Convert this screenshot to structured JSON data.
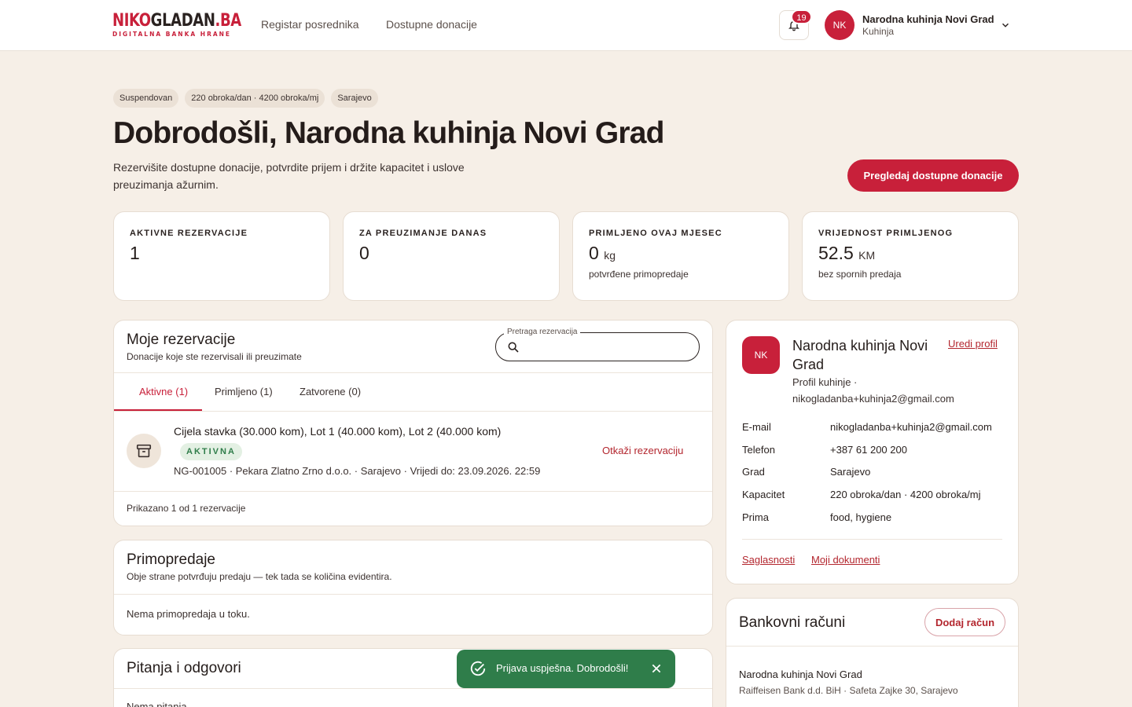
{
  "brand": {
    "logo_part1": "NIKO",
    "logo_part2": "GLADAN",
    "logo_part3": ".BA",
    "tagline": "DIGITALNA BANKA HRANE",
    "accent": "#c8203a"
  },
  "nav": {
    "link1": "Registar posrednika",
    "link2": "Dostupne donacije"
  },
  "header": {
    "notifications_count": "19",
    "user_initials": "NK",
    "user_name": "Narodna kuhinja Novi Grad",
    "user_role": "Kuhinja"
  },
  "hero": {
    "chips": [
      "Suspendovan",
      "220 obroka/dan · 4200 obroka/mj",
      "Sarajevo"
    ],
    "title": "Dobrodošli, Narodna kuhinja Novi Grad",
    "subtitle": "Rezervišite dostupne donacije, potvrdite prijem i držite kapacitet i uslove preuzimanja ažurnim.",
    "cta": "Pregledaj dostupne donacije"
  },
  "stats": [
    {
      "label": "AKTIVNE REZERVACIJE",
      "value": "1",
      "unit": "",
      "note": ""
    },
    {
      "label": "ZA PREUZIMANJE DANAS",
      "value": "0",
      "unit": "",
      "note": ""
    },
    {
      "label": "PRIMLJENO OVAJ MJESEC",
      "value": "0",
      "unit": "kg",
      "note": "potvrđene primopredaje"
    },
    {
      "label": "VRIJEDNOST PRIMLJENOG",
      "value": "52.5",
      "unit": "KM",
      "note": "bez spornih predaja"
    }
  ],
  "reservations": {
    "title": "Moje rezervacije",
    "description": "Donacije koje ste rezervisali ili preuzimate",
    "search_label": "Pretraga rezervacija",
    "search_value": "",
    "tabs": [
      "Aktivne (1)",
      "Primljeno (1)",
      "Zatvorene (0)"
    ],
    "items": [
      {
        "title": "Cijela stavka (30.000 kom), Lot 1 (40.000 kom), Lot 2 (40.000 kom)",
        "status": "AKTIVNA",
        "meta": "NG-001005 · Pekara Zlatno Zrno d.o.o. · Sarajevo · Vrijedi do: 23.09.2026. 22:59",
        "action": "Otkaži rezervaciju"
      }
    ],
    "footer": "Prikazano 1 od 1 rezervacije"
  },
  "handovers": {
    "title": "Primopredaje",
    "description": "Obje strane potvrđuju predaju — tek tada se količina evidentira.",
    "empty": "Nema primopredaja u toku."
  },
  "qa": {
    "title": "Pitanja i odgovori",
    "empty": "Nema pitanja"
  },
  "profile": {
    "initials": "NK",
    "name": "Narodna kuhinja Novi Grad",
    "edit": "Uredi profil",
    "subtitle": "Profil kuhinje · nikogladanba+kuhinja2@gmail.com",
    "fields": [
      {
        "key": "E-mail",
        "value": "nikogladanba+kuhinja2@gmail.com"
      },
      {
        "key": "Telefon",
        "value": "+387 61 200 200"
      },
      {
        "key": "Grad",
        "value": "Sarajevo"
      },
      {
        "key": "Kapacitet",
        "value": "220 obroka/dan · 4200 obroka/mj"
      },
      {
        "key": "Prima",
        "value": "food, hygiene"
      }
    ],
    "link1": "Saglasnosti",
    "link2": "Moji dokumenti"
  },
  "bank": {
    "title": "Bankovni računi",
    "add": "Dodaj račun",
    "account_name": "Narodna kuhinja Novi Grad",
    "account_bank": "Raiffeisen Bank d.d. BiH · Safeta Zajke 30, Sarajevo"
  },
  "toast": {
    "text": "Prijava uspješna. Dobrodošli!",
    "color": "#2f7d4a"
  }
}
